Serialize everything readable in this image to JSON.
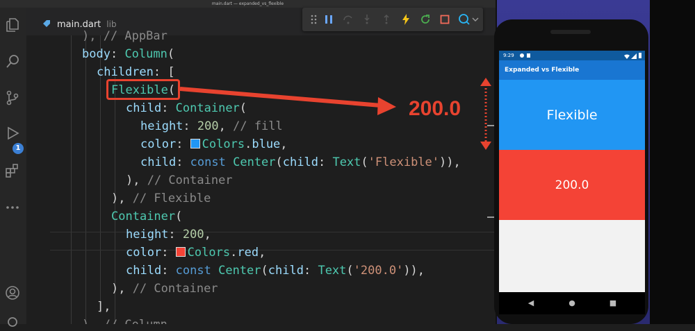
{
  "window": {
    "title": "main.dart — expanded_vs_flexible"
  },
  "activity_bar": {
    "badge": "1"
  },
  "tab": {
    "name": "main.dart",
    "path": "lib"
  },
  "code_lines": [
    {
      "text_parts": []
    },
    {
      "a": "body",
      "b": ": ",
      "c": "Column",
      "d": "("
    },
    {
      "a": "children",
      "b": ": ["
    },
    {
      "a": "Flexible",
      "b": "("
    },
    {
      "a": "child",
      "b": ": ",
      "c": "Container",
      "d": "("
    },
    {
      "a": "height",
      "b": ": ",
      "n": "200",
      "d": ", ",
      "cm": "// fill"
    },
    {
      "a": "color",
      "b": ": ",
      "c": "Colors",
      "d": ".",
      "e": "blue",
      "f": ","
    },
    {
      "a": "child",
      "b": ": ",
      "k": "const",
      "c": "Center",
      "d": "(",
      "a2": "child",
      "b2": ": ",
      "c2": "Text",
      "s": "'Flexible'",
      "f": ")),"
    },
    {
      "d": "), ",
      "cm": "// Container"
    },
    {
      "d": "), ",
      "cm": "// Flexible"
    },
    {
      "c": "Container",
      "d": "("
    },
    {
      "a": "height",
      "b": ": ",
      "n": "200",
      "d": ","
    },
    {
      "a": "color",
      "b": ": ",
      "c": "Colors",
      "d": ".",
      "e": "red",
      "f": ","
    },
    {
      "a": "child",
      "b": ": ",
      "k": "const",
      "c": "Center",
      "d": "(",
      "a2": "child",
      "b2": ": ",
      "c2": "Text",
      "s": "'200.0'",
      "f": ")),"
    },
    {
      "d": "), ",
      "cm": "// Container"
    },
    {
      "d": "],"
    }
  ],
  "partial_top_comment": "), // AppBar",
  "partial_bottom": "), // Column",
  "annotation": {
    "label": "200.0",
    "color": "#e8432f"
  },
  "phone": {
    "status_time": "9:29",
    "appbar_title": "Expanded vs Flexible",
    "blue_text": "Flexible",
    "red_text": "200.0",
    "colors": {
      "blue": "#2196f3",
      "red": "#f44336",
      "appbar": "#1976d2"
    }
  }
}
